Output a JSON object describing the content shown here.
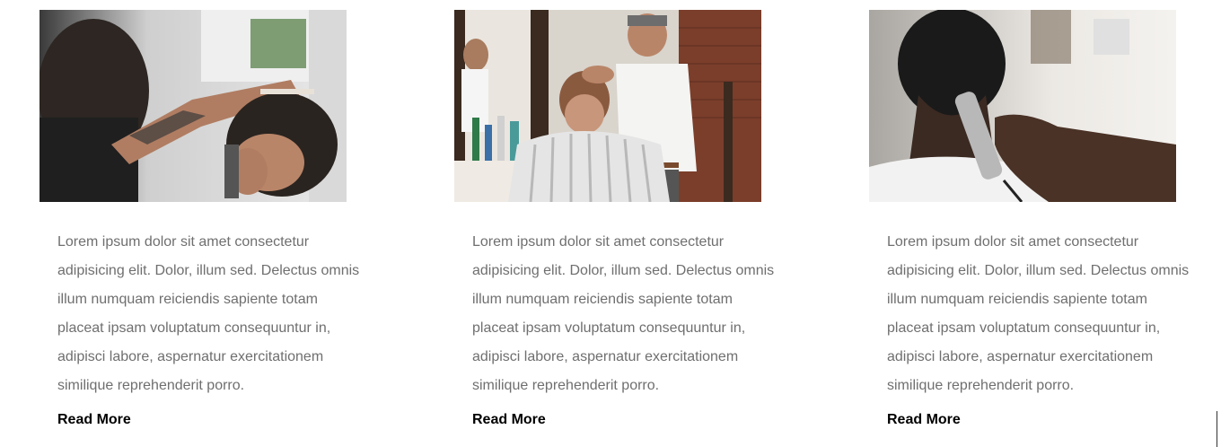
{
  "cards": [
    {
      "image": "barber-trimming-neckline-photo",
      "text": "Lorem ipsum dolor sit amet consectetur adipisicing elit. Dolor, illum sed. Delectus omnis illum numquam reiciendis sapiente totam placeat ipsam voluptatum consequuntur in, adipisci labore, aspernatur exercitationem similique reprehenderit porro.",
      "link": "Read More"
    },
    {
      "image": "barber-styling-hair-photo",
      "text": "Lorem ipsum dolor sit amet consectetur adipisicing elit. Dolor, illum sed. Delectus omnis illum numquam reiciendis sapiente totam placeat ipsam voluptatum consequuntur in, adipisci labore, aspernatur exercitationem similique reprehenderit porro.",
      "link": "Read More"
    },
    {
      "image": "clipper-fade-haircut-photo",
      "text": "Lorem ipsum dolor sit amet consectetur adipisicing elit. Dolor, illum sed. Delectus omnis illum numquam reiciendis sapiente totam placeat ipsam voluptatum consequuntur in, adipisci labore, aspernatur exercitationem similique reprehenderit porro.",
      "link": "Read More"
    }
  ],
  "colors": {
    "body_text": "#6f6f6f",
    "link": "#000000",
    "background": "#ffffff"
  }
}
